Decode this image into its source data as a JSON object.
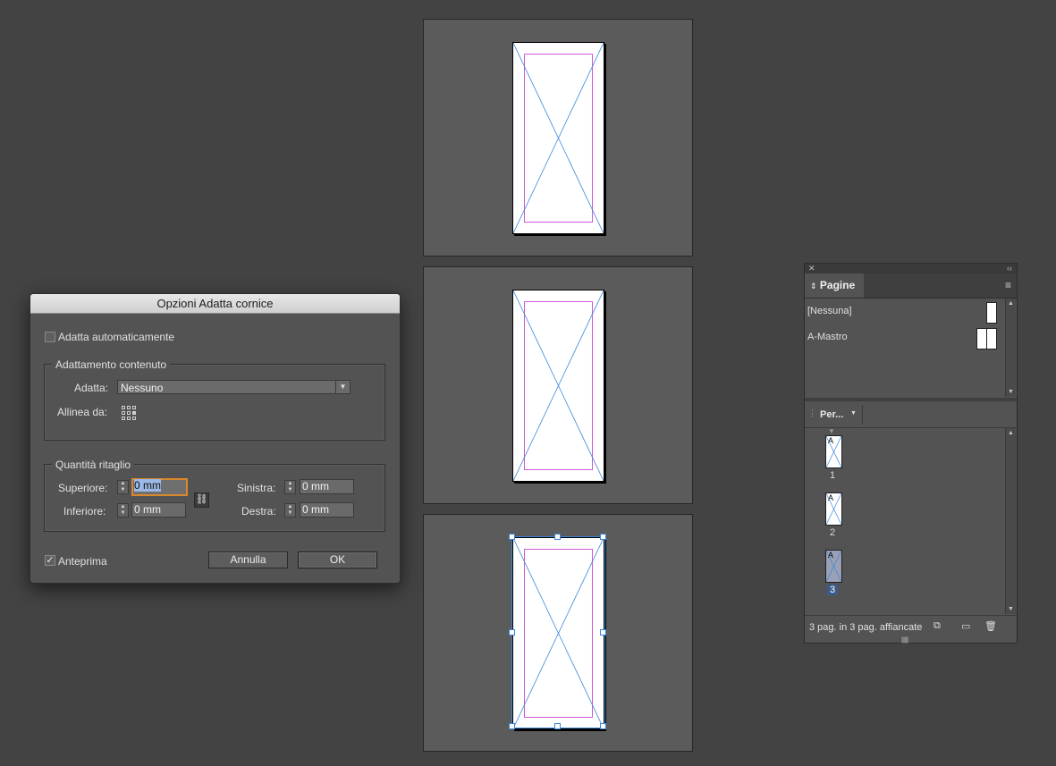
{
  "dialog": {
    "title": "Opzioni Adatta cornice",
    "auto_fit_label": "Adatta automaticamente",
    "auto_fit_checked": false,
    "content_fitting": {
      "group_title": "Adattamento contenuto",
      "fit_label": "Adatta:",
      "fit_value": "Nessuno",
      "align_label": "Allinea da:"
    },
    "crop_amount": {
      "group_title": "Quantità ritaglio",
      "top_label": "Superiore:",
      "top_value": "0 mm",
      "bottom_label": "Inferiore:",
      "bottom_value": "0 mm",
      "left_label": "Sinistra:",
      "left_value": "0 mm",
      "right_label": "Destra:",
      "right_value": "0 mm"
    },
    "preview_label": "Anteprima",
    "preview_checked": true,
    "cancel_label": "Annulla",
    "ok_label": "OK"
  },
  "pages_panel": {
    "tab_label": "Pagine",
    "masters": [
      {
        "label": "[Nessuna]"
      },
      {
        "label": "A-Mastro"
      }
    ],
    "view_label": "Per...",
    "pages": [
      {
        "num": "1",
        "master": "A",
        "selected": false
      },
      {
        "num": "2",
        "master": "A",
        "selected": false
      },
      {
        "num": "3",
        "master": "A",
        "selected": true
      }
    ],
    "status": "3 pag. in 3 pag. affiancate"
  },
  "colors": {
    "accent_focus": "#d9882b",
    "selection": "#3a85d8",
    "margin_guide": "#d05ad8"
  }
}
